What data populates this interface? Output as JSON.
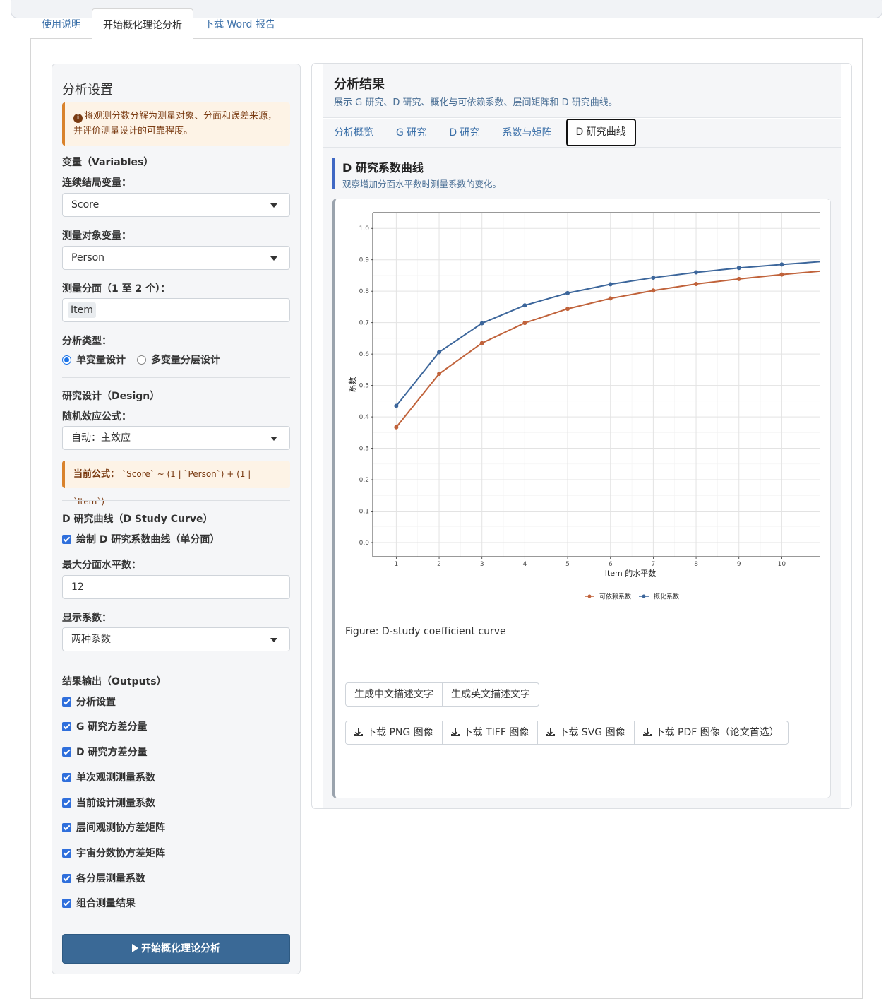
{
  "main_tabs": [
    {
      "label": "使用说明"
    },
    {
      "label": "开始概化理论分析"
    },
    {
      "label": "下载 Word 报告"
    }
  ],
  "sidebar": {
    "title": "分析设置",
    "info": "将观测分数分解为测量对象、分面和误差来源，并评价测量设计的可靠程度。",
    "variables_section": "变量（Variables）",
    "outcome_label": "连续结局变量：",
    "outcome_value": "Score",
    "object_label": "测量对象变量：",
    "object_value": "Person",
    "facet_label": "测量分面（1 至 2 个）：",
    "facet_value": "Item",
    "analysis_type_label": "分析类型：",
    "radio_univariate": "单变量设计",
    "radio_multivariate": "多变量分层设计",
    "design_section": "研究设计（Design）",
    "formula_label": "随机效应公式：",
    "formula_value": "自动：主效应",
    "current_formula_label": "当前公式：",
    "current_formula_value": "`Score` ~ (1 | `Person`) + (1 | `Item`)",
    "dcurve_section": "D 研究曲线（D Study Curve）",
    "dcurve_check": "绘制 D 研究系数曲线（单分面）",
    "max_levels_label": "最大分面水平数：",
    "max_levels_value": "12",
    "coef_label": "显示系数：",
    "coef_value": "两种系数",
    "outputs_section": "结果输出（Outputs）",
    "outputs": [
      "分析设置",
      "G 研究方差分量",
      "D 研究方差分量",
      "单次观测测量系数",
      "当前设计测量系数",
      "层间观测协方差矩阵",
      "宇宙分数协方差矩阵",
      "各分层测量系数",
      "组合测量结果"
    ],
    "run_button": "开始概化理论分析"
  },
  "results": {
    "title": "分析结果",
    "subtitle": "展示 G 研究、D 研究、概化与可依赖系数、层间矩阵和 D 研究曲线。",
    "tabs": [
      "分析概览",
      "G 研究",
      "D 研究",
      "系数与矩阵",
      "D 研究曲线"
    ],
    "section_title": "D 研究系数曲线",
    "section_sub": "观察增加分面水平数时测量系数的变化。",
    "caption": "Figure: D-study coefficient curve",
    "text_buttons": [
      "生成中文描述文字",
      "生成英文描述文字"
    ],
    "download_buttons": [
      "下载 PNG 图像",
      "下载 TIFF 图像",
      "下载 SVG 图像",
      "下载 PDF 图像（论文首选）"
    ]
  },
  "chart_data": {
    "type": "line",
    "xlabel": "Item 的水平数",
    "ylabel": "系数",
    "x": [
      1,
      2,
      3,
      4,
      5,
      6,
      7,
      8,
      9,
      10,
      11
    ],
    "xticks": [
      1,
      2,
      3,
      4,
      5,
      6,
      7,
      8,
      9,
      10
    ],
    "ylim": [
      0.0,
      1.0
    ],
    "yticks": [
      "0.0",
      "0.1",
      "0.2",
      "0.3",
      "0.4",
      "0.5",
      "0.6",
      "0.7",
      "0.8",
      "0.9",
      "1.0"
    ],
    "grid": true,
    "legend_position": "bottom",
    "series": [
      {
        "name": "可依赖系数",
        "color": "#c0623a",
        "values": [
          0.367,
          0.537,
          0.635,
          0.699,
          0.744,
          0.777,
          0.802,
          0.823,
          0.839,
          0.853,
          0.865
        ]
      },
      {
        "name": "概化系数",
        "color": "#3c669b",
        "values": [
          0.435,
          0.606,
          0.698,
          0.755,
          0.794,
          0.822,
          0.843,
          0.86,
          0.874,
          0.885,
          0.895
        ]
      }
    ]
  }
}
